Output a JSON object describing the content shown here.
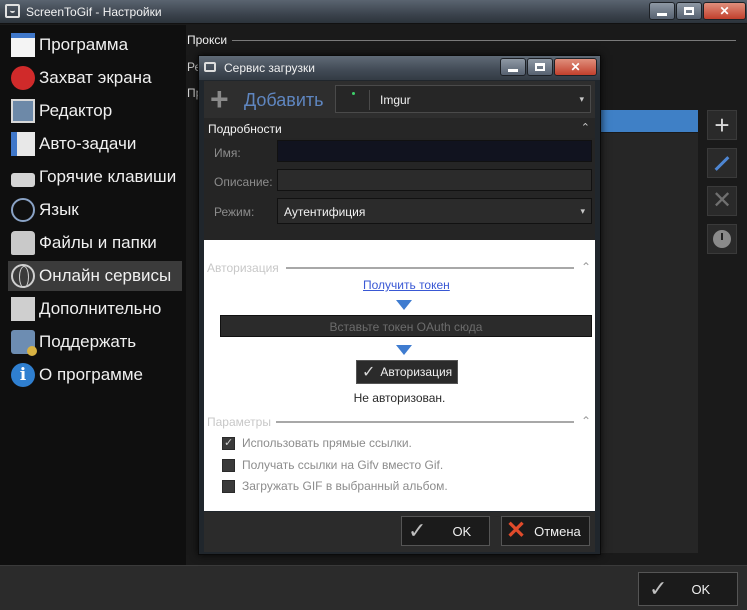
{
  "window": {
    "title": "ScreenToGif - Настройки"
  },
  "sidebar": {
    "items": [
      {
        "label": "Программа",
        "icon": "window-icon"
      },
      {
        "label": "Захват экрана",
        "icon": "record-icon"
      },
      {
        "label": "Редактор",
        "icon": "editor-icon"
      },
      {
        "label": "Авто-задачи",
        "icon": "tasks-icon"
      },
      {
        "label": "Горячие клавиши",
        "icon": "keyboard-icon"
      },
      {
        "label": "Язык",
        "icon": "language-icon"
      },
      {
        "label": "Файлы и папки",
        "icon": "folders-icon"
      },
      {
        "label": "Онлайн сервисы",
        "icon": "globe-icon",
        "active": true
      },
      {
        "label": "Дополнительно",
        "icon": "extras-icon"
      },
      {
        "label": "Поддержать",
        "icon": "support-icon"
      },
      {
        "label": "О программе",
        "icon": "info-icon"
      }
    ]
  },
  "content": {
    "proxy_header": "Прокси",
    "partial_label_1": "Ре",
    "partial_label_2": "Пр"
  },
  "footer": {
    "ok_label": "OK"
  },
  "dialog": {
    "title": "Сервис загрузки",
    "add_label": "Добавить",
    "service": "Imgur",
    "details_header": "Подробности",
    "name_label": "Имя:",
    "name_value": "",
    "description_label": "Описание:",
    "description_value": "",
    "mode_label": "Режим:",
    "mode_value": "Аутентифиция",
    "authorization_group": "Авторизация",
    "get_token_link": "Получить токен",
    "token_placeholder": "Вставьте токен OAuth сюда",
    "authorize_button": "Авторизация",
    "status_text": "Не авторизован.",
    "parameters_group": "Параметры",
    "options": [
      {
        "label": "Использовать прямые ссылки.",
        "checked": true
      },
      {
        "label": "Получать ссылки на Gifv вместо Gif.",
        "checked": false
      },
      {
        "label": "Загружать GIF в выбранный альбом.",
        "checked": false
      }
    ],
    "ok_label": "OK",
    "cancel_label": "Отмена"
  },
  "colors": {
    "accent_blue": "#3f80c6",
    "cancel_red": "#e14b2b",
    "link_blue": "#3958d4"
  }
}
